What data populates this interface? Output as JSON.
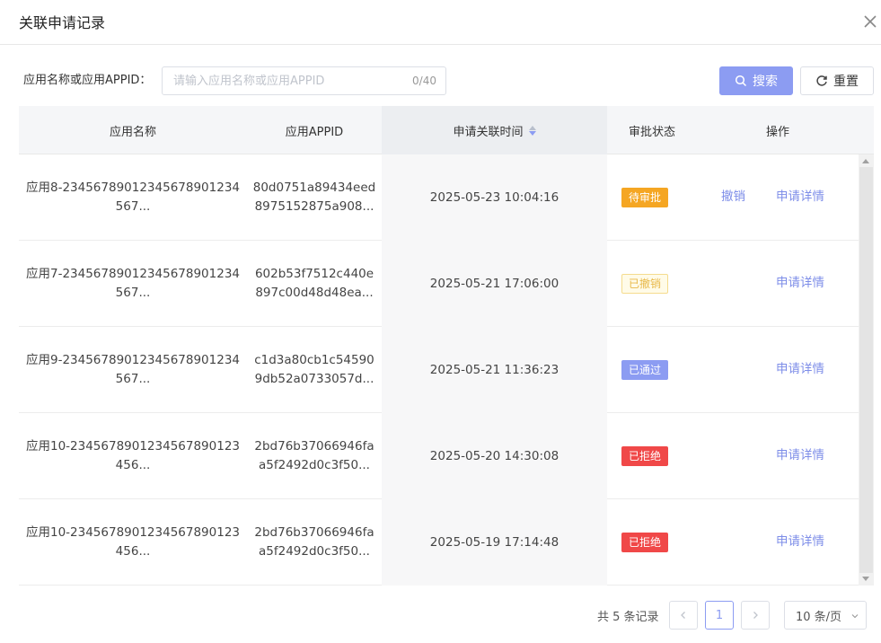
{
  "dialog": {
    "title": "关联申请记录"
  },
  "search": {
    "label": "应用名称或应用APPID：",
    "placeholder": "请输入应用名称或应用APPID",
    "value": "",
    "counter": "0/40",
    "search_label": "搜索",
    "reset_label": "重置"
  },
  "table": {
    "columns": [
      "应用名称",
      "应用APPID",
      "申请关联时间",
      "审批状态",
      "操作"
    ],
    "rows": [
      {
        "name": "应用8-23456789012345678901234567...",
        "appid": "80d0751a89434eed8975152875a908...",
        "time": "2025-05-23 10:04:16",
        "status": "待审批",
        "status_kind": "pending",
        "revoke": "撤销",
        "detail": "申请详情"
      },
      {
        "name": "应用7-23456789012345678901234567...",
        "appid": "602b53f7512c440e897c00d48d48ea...",
        "time": "2025-05-21 17:06:00",
        "status": "已撤销",
        "status_kind": "revoked",
        "revoke": "",
        "detail": "申请详情"
      },
      {
        "name": "应用9-23456789012345678901234567...",
        "appid": "c1d3a80cb1c545909db52a0733057d...",
        "time": "2025-05-21 11:36:23",
        "status": "已通过",
        "status_kind": "approved",
        "revoke": "",
        "detail": "申请详情"
      },
      {
        "name": "应用10-2345678901234567890123456...",
        "appid": "2bd76b37066946faa5f2492d0c3f50...",
        "time": "2025-05-20 14:30:08",
        "status": "已拒绝",
        "status_kind": "rejected",
        "revoke": "",
        "detail": "申请详情"
      },
      {
        "name": "应用10-2345678901234567890123456...",
        "appid": "2bd76b37066946faa5f2492d0c3f50...",
        "time": "2025-05-19 17:14:48",
        "status": "已拒绝",
        "status_kind": "rejected",
        "revoke": "",
        "detail": "申请详情"
      }
    ]
  },
  "status_colors": {
    "pending": {
      "bg": "#f5a623",
      "fg": "#ffffff",
      "border": "#f5a623"
    },
    "revoked": {
      "bg": "#fffbe8",
      "fg": "#e8b94a",
      "border": "#f5dc8e"
    },
    "approved": {
      "bg": "#8c9cf2",
      "fg": "#ffffff",
      "border": "#8c9cf2"
    },
    "rejected": {
      "bg": "#f04848",
      "fg": "#ffffff",
      "border": "#f04848"
    }
  },
  "pagination": {
    "total_text": "共 5 条记录",
    "current_page": "1",
    "page_size": "10 条/页"
  },
  "icons": {
    "close": "close-icon",
    "search": "search-icon",
    "reset": "refresh-icon",
    "sort": "sort-icon",
    "prev": "chevron-left-icon",
    "next": "chevron-right-icon",
    "dropdown": "chevron-down-icon"
  }
}
